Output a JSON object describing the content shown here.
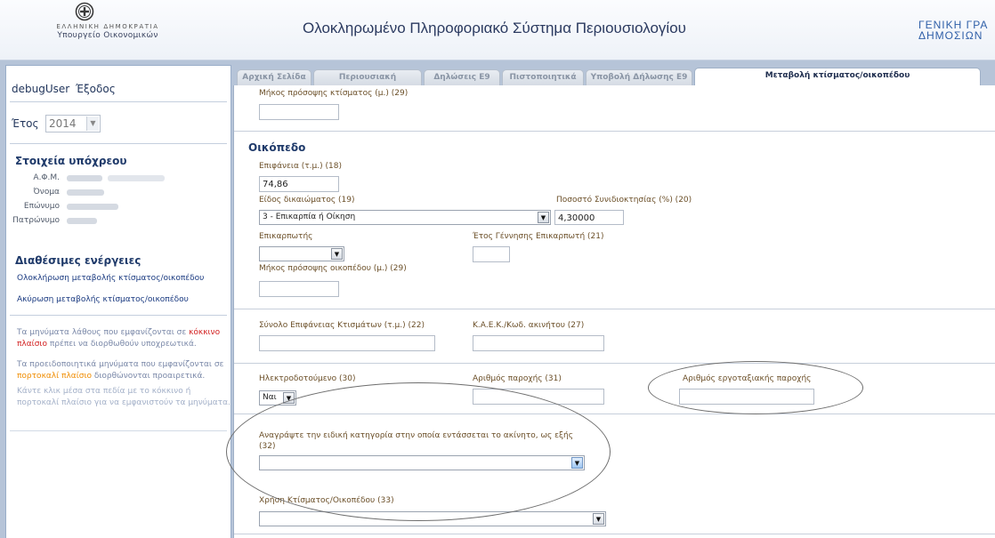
{
  "header": {
    "emblem_line1": "ΕΛΛΗΝΙΚΗ ΔΗΜΟΚΡΑΤΙΑ",
    "emblem_line2": "Υπουργείο Οικονομικών",
    "system_title": "Ολοκληρωμένο Πληροφοριακό Σύστημα Περιουσιολογίου",
    "right_title": "ΓΕΝΙΚΗ ΓΡΑ\nΔΗΜΟΣΙΩΝ"
  },
  "sidebar": {
    "user": "debugUser",
    "logout": "Έξοδος",
    "year_label": "Έτος",
    "year_value": "2014",
    "debtor_title": "Στοιχεία υπόχρεου",
    "fields": [
      "Α.Φ.Μ.",
      "Όνομα",
      "Επώνυμο",
      "Πατρώνυμο"
    ],
    "actions_title": "Διαθέσιμες ενέργειες",
    "actions": [
      "Ολοκλήρωση μεταβολής κτίσματος/οικοπέδου",
      "Ακύρωση μεταβολής κτίσματος/οικοπέδου"
    ],
    "msg1_a": "Τα μηνύματα λάθους που εμφανίζονται σε ",
    "msg1_red": "κόκκινο πλαίσιο",
    "msg1_b": " πρέπει να διορθωθούν υποχρεωτικά.",
    "msg2_a": "Τα προειδοποιητικά μηνύματα που εμφανίζονται σε ",
    "msg2_orange": "πορτοκαλί πλαίσιο",
    "msg2_b": " διορθώνονται προαιρετικά.",
    "msg3": "Κάντε κλικ μέσα στα πεδία με το κόκκινο ή πορτοκαλί πλαίσιο για να εμφανιστούν τα μηνύματα."
  },
  "tabs": [
    "Αρχική Σελίδα",
    "Περιουσιακή Κατάσταση",
    "Δηλώσεις Ε9",
    "Πιστοποιητικά",
    "Υποβολή Δήλωσης Ε9",
    "Μεταβολή κτίσματος/οικοπέδου"
  ],
  "active_tab_index": 5,
  "form": {
    "building_frontage_label": "Μήκος πρόσοψης κτίσματος (μ.) (29)",
    "plot_section_title": "Οικόπεδο",
    "area_label": "Επιφάνεια (τ.μ.) (18)",
    "area_value": "74,86",
    "right_type_label": "Είδος δικαιώματος (19)",
    "right_type_value": "3 - Επικαρπία ή Οίκηση",
    "coownership_label": "Ποσοστό Συνιδιοκτησίας (%) (20)",
    "coownership_value": "4,30000",
    "usufructuary_label": "Επικαρπωτής",
    "usufructuary_birth_label": "Έτος Γέννησης Επικαρπωτή (21)",
    "plot_frontage_label": "Μήκος πρόσοψης οικοπέδου (μ.) (29)",
    "total_buildings_area_label": "Σύνολο Επιφάνειας Κτισμάτων (τ.μ.) (22)",
    "kaek_label": "Κ.Α.Ε.Κ./Κωδ. ακινήτου (27)",
    "electrified_label": "Ηλεκτροδοτούμενο (30)",
    "electrified_value": "Ναι",
    "supply_number_label": "Αριθμός παροχής (31)",
    "construction_supply_label": "Αριθμός εργοταξιακής παροχής",
    "special_category_label_line1": "Αναγράψτε την ειδική κατηγορία στην οποία εντάσσεται το ακίνητο, ως εξής",
    "special_category_label_line2": "(32)",
    "usage_label": "Χρήση Κτίσματος/Οικοπέδου (33)"
  }
}
